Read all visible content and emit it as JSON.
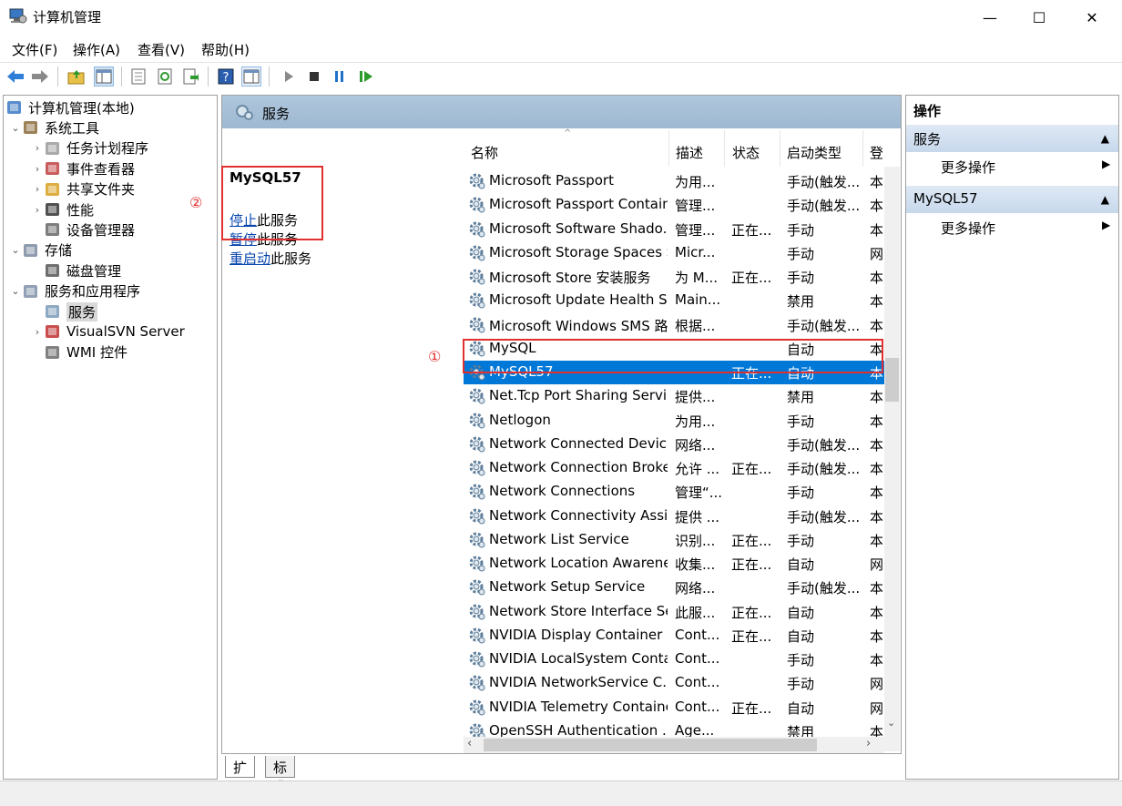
{
  "window": {
    "title": "计算机管理",
    "min": "—",
    "max": "☐",
    "close": "✕"
  },
  "menu": [
    "文件(F)",
    "操作(A)",
    "查看(V)",
    "帮助(H)"
  ],
  "tree": [
    {
      "label": "计算机管理(本地)",
      "level": 0,
      "arrow": "",
      "icon": "computer-management-icon"
    },
    {
      "label": "系统工具",
      "level": 1,
      "arrow": "⌄",
      "icon": "system-tools-icon"
    },
    {
      "label": "任务计划程序",
      "level": 2,
      "arrow": "›",
      "icon": "task-scheduler-icon"
    },
    {
      "label": "事件查看器",
      "level": 2,
      "arrow": "›",
      "icon": "event-viewer-icon"
    },
    {
      "label": "共享文件夹",
      "level": 2,
      "arrow": "›",
      "icon": "shared-folders-icon"
    },
    {
      "label": "性能",
      "level": 2,
      "arrow": "›",
      "icon": "performance-icon"
    },
    {
      "label": "设备管理器",
      "level": 2,
      "arrow": "",
      "icon": "device-manager-icon"
    },
    {
      "label": "存储",
      "level": 1,
      "arrow": "⌄",
      "icon": "storage-icon"
    },
    {
      "label": "磁盘管理",
      "level": 2,
      "arrow": "",
      "icon": "disk-management-icon"
    },
    {
      "label": "服务和应用程序",
      "level": 1,
      "arrow": "⌄",
      "icon": "services-apps-icon"
    },
    {
      "label": "服务",
      "level": 2,
      "arrow": "",
      "icon": "services-icon",
      "selected": true
    },
    {
      "label": "VisualSVN Server",
      "level": 2,
      "arrow": "›",
      "icon": "visualsvn-icon"
    },
    {
      "label": "WMI 控件",
      "level": 2,
      "arrow": "",
      "icon": "wmi-icon"
    }
  ],
  "middle": {
    "header": "服务",
    "service_name": "MySQL57",
    "actions": [
      {
        "link": "停止",
        "rest": "此服务"
      },
      {
        "link": "暂停",
        "rest": "此服务"
      },
      {
        "link": "重启动",
        "rest": "此服务"
      }
    ],
    "columns": [
      "名称",
      "描述",
      "状态",
      "启动类型",
      "登"
    ],
    "rows": [
      {
        "name": "Microsoft Passport",
        "desc": "为用...",
        "status": "",
        "startup": "手动(触发...",
        "logon": "本"
      },
      {
        "name": "Microsoft Passport Container",
        "desc": "管理...",
        "status": "",
        "startup": "手动(触发...",
        "logon": "本"
      },
      {
        "name": "Microsoft Software Shado...",
        "desc": "管理...",
        "status": "正在...",
        "startup": "手动",
        "logon": "本"
      },
      {
        "name": "Microsoft Storage Spaces S...",
        "desc": "Micr...",
        "status": "",
        "startup": "手动",
        "logon": "网"
      },
      {
        "name": "Microsoft Store 安装服务",
        "desc": "为 M...",
        "status": "正在...",
        "startup": "手动",
        "logon": "本"
      },
      {
        "name": "Microsoft Update Health S...",
        "desc": "Main...",
        "status": "",
        "startup": "禁用",
        "logon": "本"
      },
      {
        "name": "Microsoft Windows SMS 路...",
        "desc": "根据...",
        "status": "",
        "startup": "手动(触发...",
        "logon": "本"
      },
      {
        "name": "MySQL",
        "desc": "",
        "status": "",
        "startup": "自动",
        "logon": "本"
      },
      {
        "name": "MySQL57",
        "desc": "",
        "status": "正在...",
        "startup": "自动",
        "logon": "本",
        "selected": true
      },
      {
        "name": "Net.Tcp Port Sharing Service",
        "desc": "提供...",
        "status": "",
        "startup": "禁用",
        "logon": "本"
      },
      {
        "name": "Netlogon",
        "desc": "为用...",
        "status": "",
        "startup": "手动",
        "logon": "本"
      },
      {
        "name": "Network Connected Devic...",
        "desc": "网络...",
        "status": "",
        "startup": "手动(触发...",
        "logon": "本"
      },
      {
        "name": "Network Connection Broker",
        "desc": "允许 ...",
        "status": "正在...",
        "startup": "手动(触发...",
        "logon": "本"
      },
      {
        "name": "Network Connections",
        "desc": "管理“...",
        "status": "",
        "startup": "手动",
        "logon": "本"
      },
      {
        "name": "Network Connectivity Assis...",
        "desc": "提供 ...",
        "status": "",
        "startup": "手动(触发...",
        "logon": "本"
      },
      {
        "name": "Network List Service",
        "desc": "识别...",
        "status": "正在...",
        "startup": "手动",
        "logon": "本"
      },
      {
        "name": "Network Location Awarene...",
        "desc": "收集...",
        "status": "正在...",
        "startup": "自动",
        "logon": "网"
      },
      {
        "name": "Network Setup Service",
        "desc": "网络...",
        "status": "",
        "startup": "手动(触发...",
        "logon": "本"
      },
      {
        "name": "Network Store Interface Se...",
        "desc": "此服...",
        "status": "正在...",
        "startup": "自动",
        "logon": "本"
      },
      {
        "name": "NVIDIA Display Container LS",
        "desc": "Cont...",
        "status": "正在...",
        "startup": "自动",
        "logon": "本"
      },
      {
        "name": "NVIDIA LocalSystem Conta...",
        "desc": "Cont...",
        "status": "",
        "startup": "手动",
        "logon": "本"
      },
      {
        "name": "NVIDIA NetworkService C...",
        "desc": "Cont...",
        "status": "",
        "startup": "手动",
        "logon": "网"
      },
      {
        "name": "NVIDIA Telemetry Container",
        "desc": "Cont...",
        "status": "正在...",
        "startup": "自动",
        "logon": "网"
      },
      {
        "name": "OpenSSH Authentication ...",
        "desc": "Age...",
        "status": "",
        "startup": "禁用",
        "logon": "本"
      }
    ],
    "tabs": [
      "扩展",
      "标准"
    ]
  },
  "right": {
    "title": "操作",
    "sections": [
      {
        "header": "服务",
        "item": "更多操作"
      },
      {
        "header": "MySQL57",
        "item": "更多操作"
      }
    ]
  },
  "annotations": {
    "one": "①",
    "two": "②"
  },
  "colors": {
    "selection": "#0078d7",
    "annotation": "#e03030",
    "header": "#9db8d2"
  }
}
